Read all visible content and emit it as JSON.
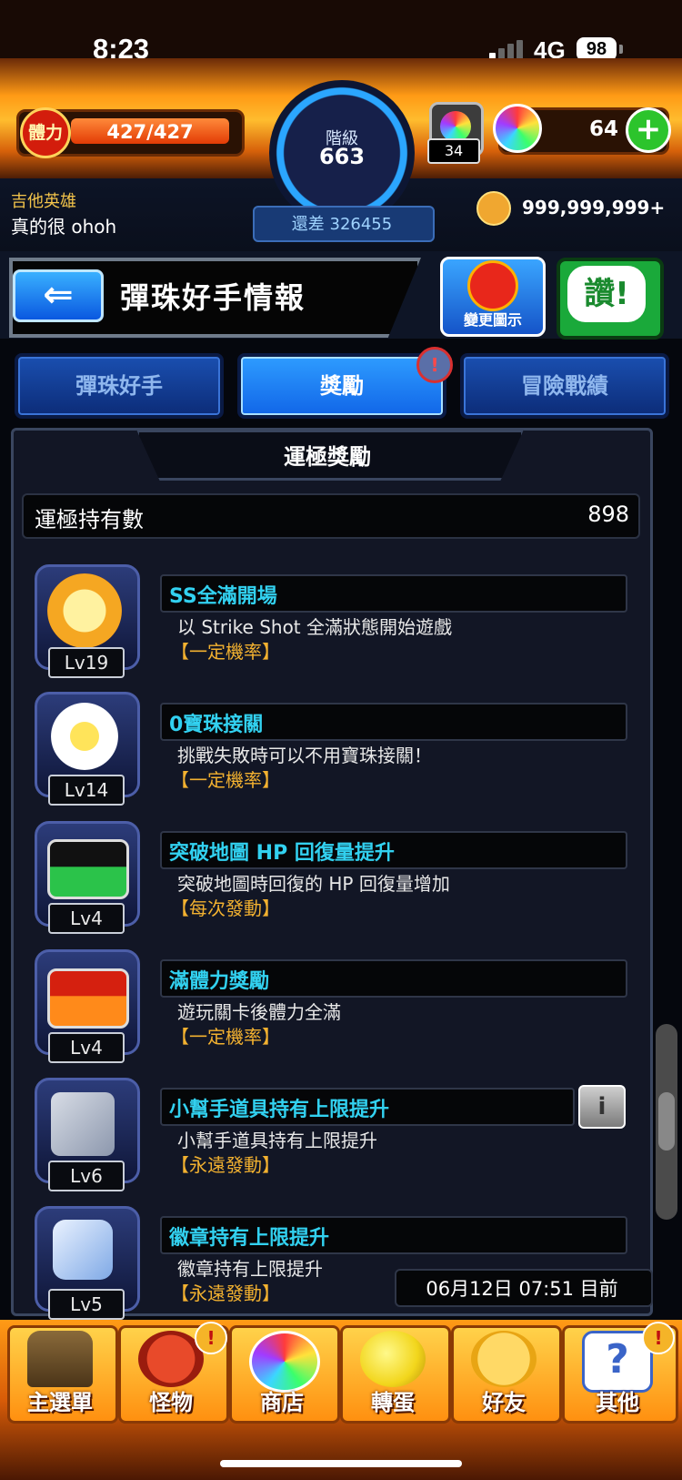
{
  "status_bar": {
    "time": "8:23",
    "network": "4G",
    "battery": "98"
  },
  "header": {
    "stamina_icon_text": "體力",
    "stamina": "427/427",
    "stamina_fraction": 1.0,
    "rank_label": "階級",
    "rank": "663",
    "rank_next": "還差 326455",
    "luck_item_count": "34",
    "orbs": "64",
    "player_title": "吉他英雄",
    "player_name": "真的很 ohoh",
    "coins": "999,999,999+"
  },
  "page": {
    "title": "彈珠好手情報",
    "change_icon_label": "變更圖示",
    "like_label": "讚!"
  },
  "tabs": [
    {
      "label": "彈珠好手",
      "active": false
    },
    {
      "label": "獎勵",
      "active": true,
      "alert": "!"
    },
    {
      "label": "冒險戰績",
      "active": false
    }
  ],
  "panel": {
    "title": "運極獎勵",
    "luck_row_label": "運極持有數",
    "luck_row_value": "898",
    "timestamp": "06月12日 07:51 目前"
  },
  "abilities": [
    {
      "icon": "go-burst-icon",
      "level": "Lv19",
      "name": "SS全滿開場",
      "desc": "以 Strike Shot 全滿狀態開始遊戲",
      "type": "【一定機率】"
    },
    {
      "icon": "winged-arrow-icon",
      "level": "Lv14",
      "name": "0寶珠接關",
      "desc": "挑戰失敗時可以不用寶珠接關！",
      "type": "【一定機率】"
    },
    {
      "icon": "hp-arrow-icon",
      "level": "Lv4",
      "name": "突破地圖 HP 回復量提升",
      "desc": "突破地圖時回復的 HP 回復量增加",
      "type": "【每次發動】"
    },
    {
      "icon": "stamina-arrow-icon",
      "level": "Lv4",
      "name": "滿體力獎勵",
      "desc": "遊玩關卡後體力全滿",
      "type": "【一定機率】"
    },
    {
      "icon": "helper-item-plus-icon",
      "level": "Lv6",
      "name": "小幫手道具持有上限提升",
      "desc": "小幫手道具持有上限提升",
      "type": "【永遠發動】"
    },
    {
      "icon": "badge-plus-icon",
      "level": "Lv5",
      "name": "徽章持有上限提升",
      "desc": "徽章持有上限提升",
      "type": "【永遠發動】"
    }
  ],
  "bottom_nav": [
    {
      "label": "主選單",
      "icon": "castle-icon"
    },
    {
      "label": "怪物",
      "icon": "monster-icon",
      "alert": "!"
    },
    {
      "label": "商店",
      "icon": "rainbow-orb-icon"
    },
    {
      "label": "轉蛋",
      "icon": "egg-icon"
    },
    {
      "label": "好友",
      "icon": "friends-icon"
    },
    {
      "label": "其他",
      "icon": "question-icon",
      "alert": "!"
    }
  ]
}
